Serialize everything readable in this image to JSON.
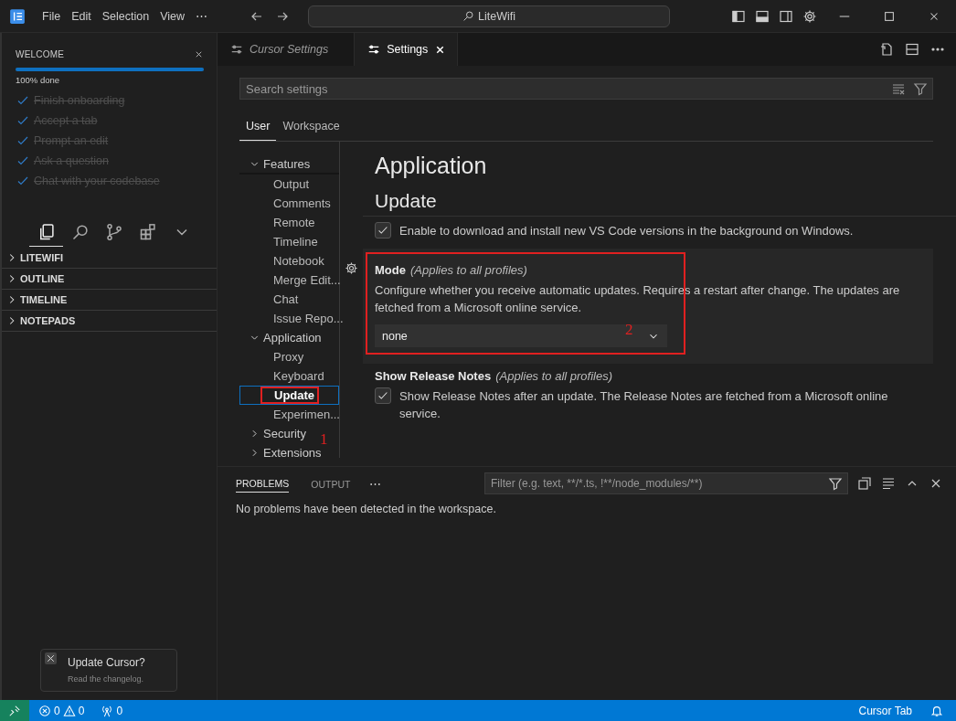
{
  "title_bar": {
    "menu": [
      "File",
      "Edit",
      "Selection",
      "View"
    ],
    "more": "⋯",
    "search": "LiteWifi"
  },
  "welcome": {
    "title": "WELCOME",
    "progress": {
      "level": 1.0,
      "label": "100% done"
    },
    "steps": [
      {
        "label": "Finish onboarding",
        "checked": true
      },
      {
        "label": "Accept a tab",
        "checked": true
      },
      {
        "label": "Prompt an edit",
        "checked": true
      },
      {
        "label": "Ask a question",
        "checked": true
      },
      {
        "label": "Chat with your codebase",
        "checked": true
      }
    ]
  },
  "activity_bar": [
    {
      "kind": "explorer",
      "selected": true
    },
    {
      "kind": "search",
      "selected": false
    },
    {
      "kind": "source-control",
      "selected": false
    },
    {
      "kind": "extensions",
      "selected": false
    },
    {
      "kind": "more",
      "selected": false
    }
  ],
  "sections": [
    {
      "label": "LITEWIFI",
      "expanded": false
    },
    {
      "label": "OUTLINE",
      "expanded": false
    },
    {
      "label": "TIMELINE",
      "expanded": false
    },
    {
      "label": "NOTEPADS",
      "expanded": false
    }
  ],
  "notification": {
    "title": "Update Cursor?",
    "text": "Read the changelog."
  },
  "editor_tabs": [
    {
      "label": "Cursor Settings",
      "selected": false
    },
    {
      "label": "Settings",
      "selected": true
    }
  ],
  "settings": {
    "search": {
      "placeholder": "Search settings"
    },
    "scope_tabs": [
      {
        "label": "User",
        "selected": true
      },
      {
        "label": "Workspace",
        "selected": false
      }
    ],
    "toc": [
      {
        "label": "Features",
        "expanded": true,
        "selected": false,
        "children": [
          {
            "label": "Output",
            "selected": false
          },
          {
            "label": "Comments",
            "selected": false
          },
          {
            "label": "Remote",
            "selected": false
          },
          {
            "label": "Timeline",
            "selected": false
          },
          {
            "label": "Notebook",
            "selected": false
          },
          {
            "label": "Merge Edit...",
            "selected": false
          },
          {
            "label": "Chat",
            "selected": false
          },
          {
            "label": "Issue Repo...",
            "selected": false
          }
        ]
      },
      {
        "label": "Application",
        "expanded": true,
        "selected": false,
        "children": [
          {
            "label": "Proxy",
            "selected": false
          },
          {
            "label": "Keyboard",
            "selected": false
          },
          {
            "label": "Update",
            "selected": true,
            "highlighted": true
          },
          {
            "label": "Experimen...",
            "selected": false
          }
        ]
      },
      {
        "label": "Security",
        "expanded": false,
        "selected": false
      },
      {
        "label": "Extensions",
        "expanded": false,
        "selected": false
      }
    ],
    "heading": "Application",
    "subheading": "Update",
    "items": [
      {
        "kind": "checkbox",
        "description": "Enable to download and install new VS Code versions in the background on Windows.",
        "checked": true
      },
      {
        "kind": "dropdown",
        "title": "Mode",
        "scope": "(Applies to all profiles)",
        "description": "Configure whether you receive automatic updates. Requires a restart after change. The updates are fetched from a Microsoft online service.",
        "value": "none",
        "focused": true,
        "highlighted": true
      },
      {
        "kind": "checkbox",
        "title": "Show Release Notes",
        "scope": "(Applies to all profiles)",
        "description": "Show Release Notes after an update. The Release Notes are fetched from a Microsoft online service.",
        "checked": true
      }
    ],
    "annotations": [
      "1",
      "2"
    ]
  },
  "panel": {
    "tabs": [
      {
        "label": "PROBLEMS",
        "selected": true
      },
      {
        "label": "OUTPUT",
        "selected": false
      }
    ],
    "more": "⋯",
    "filter": {
      "placeholder": "Filter (e.g. text, **/*.ts, !**/node_modules/**)"
    },
    "message": "No problems have been detected in the workspace."
  },
  "status_bar": {
    "errors": "0",
    "warnings": "0",
    "ports": "0",
    "right": "Cursor Tab"
  }
}
